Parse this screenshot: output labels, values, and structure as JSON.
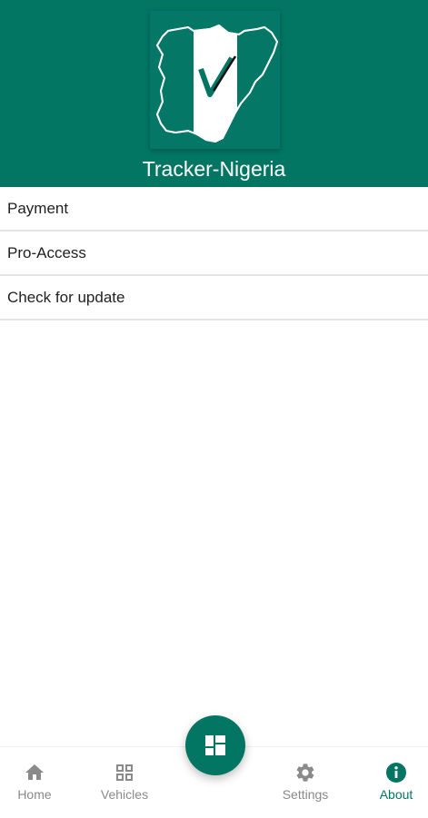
{
  "app": {
    "title": "Tracker-Nigeria",
    "logo_icon": "nigeria-map-checkmark-logo"
  },
  "menu": {
    "items": [
      {
        "label": "Payment"
      },
      {
        "label": "Pro-Access"
      },
      {
        "label": "Check for update"
      }
    ]
  },
  "bottom_nav": {
    "items": [
      {
        "label": "Home",
        "icon": "home-icon"
      },
      {
        "label": "Vehicles",
        "icon": "grid-icon"
      },
      {
        "label": "Settings",
        "icon": "gear-icon"
      },
      {
        "label": "About",
        "icon": "info-icon",
        "active": true
      }
    ],
    "fab_icon": "dashboard-icon"
  },
  "colors": {
    "primary": "#037563",
    "inactive": "#8a8a8a",
    "divider": "#e3e3e3"
  }
}
